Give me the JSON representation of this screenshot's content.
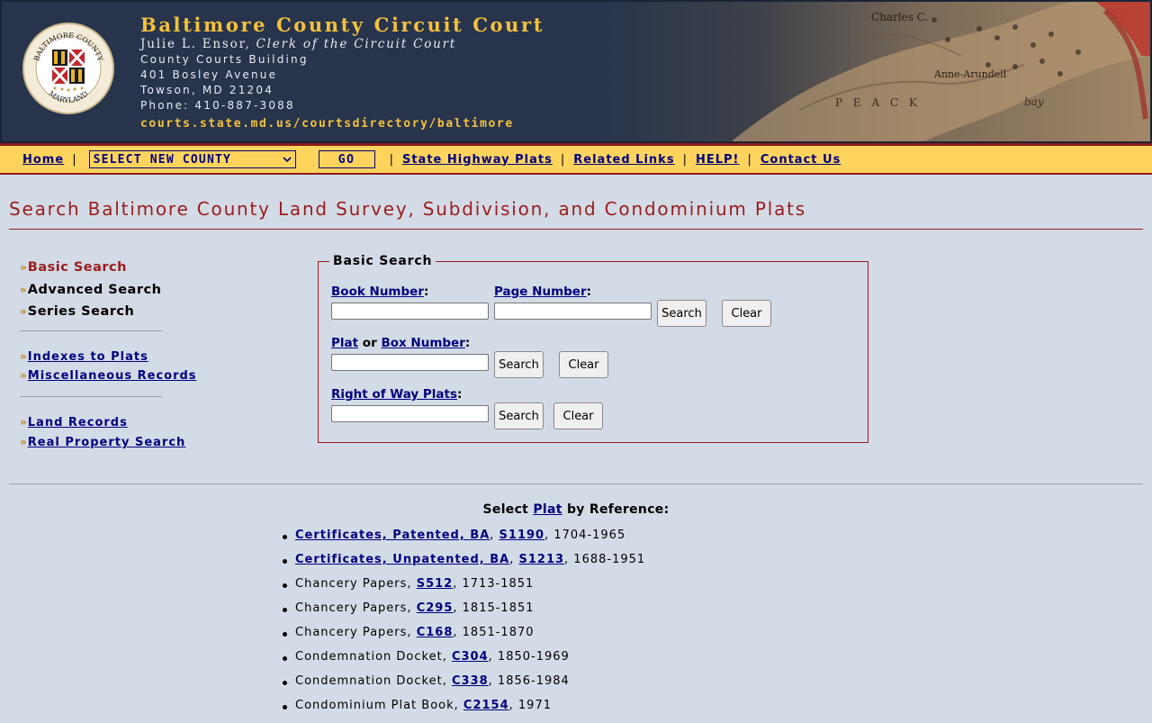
{
  "header": {
    "title": "Baltimore County Circuit Court",
    "clerk_name": "Julie L. Ensor,",
    "clerk_title": "Clerk of the Circuit Court",
    "building": "County Courts Building",
    "street": "401 Bosley Avenue",
    "city": "Towson, MD 21204",
    "phone": "Phone: 410-887-3088",
    "url": "courts.state.md.us/courtsdirectory/baltimore",
    "seal_top": "BALTIMORE COUNTY",
    "seal_bottom": "MARYLAND",
    "map_labels": [
      "Charles C.",
      "Anne-Arundell",
      "P E   A C K",
      "bay"
    ]
  },
  "nav": {
    "home": "Home",
    "sep": "|",
    "county_select": "SELECT NEW COUNTY",
    "go": "GO",
    "state_highway": "State Highway Plats",
    "related": "Related Links",
    "help": "HELP!",
    "contact": "Contact Us"
  },
  "page_title": "Search Baltimore County Land Survey, Subdivision, and Condominium Plats",
  "side": {
    "chevron": "»",
    "basic": "Basic Search",
    "advanced": "Advanced Search",
    "series": "Series Search",
    "indexes": "Indexes to Plats",
    "misc": "Miscellaneous Records",
    "land": "Land Records",
    "property": "Real Property Search"
  },
  "basic_search": {
    "legend": "Basic Search",
    "book_label": "Book Number",
    "page_label": "Page Number",
    "colon": ":",
    "plat": "Plat",
    "or": " or ",
    "box_label": "Box Number",
    "row_label": "Right of Way Plats",
    "search": "Search",
    "clear": "Clear",
    "book_value": "",
    "page_value": "",
    "plat_value": "",
    "row_value": ""
  },
  "references": {
    "head_pre": "Select ",
    "head_link": "Plat",
    "head_post": " by Reference:",
    "items": [
      {
        "pre": "",
        "link1": "Certificates, Patented, BA",
        "mid": ", ",
        "link2": "S1190",
        "post": ", 1704-1965"
      },
      {
        "pre": "",
        "link1": "Certificates, Unpatented, BA",
        "mid": ", ",
        "link2": "S1213",
        "post": ", 1688-1951"
      },
      {
        "pre": "Chancery Papers, ",
        "link2": "S512",
        "post": ", 1713-1851"
      },
      {
        "pre": "Chancery Papers, ",
        "link2": "C295",
        "post": ", 1815-1851"
      },
      {
        "pre": "Chancery Papers, ",
        "link2": "C168",
        "post": ", 1851-1870"
      },
      {
        "pre": "Condemnation Docket, ",
        "link2": "C304",
        "post": ", 1850-1969"
      },
      {
        "pre": "Condemnation Docket, ",
        "link2": "C338",
        "post": ", 1856-1984"
      },
      {
        "pre": "Condominium Plat Book, ",
        "link2": "C2154",
        "post": ", 1971"
      }
    ]
  },
  "colors": {
    "background": "#d3dbe6",
    "banner": "#27344c",
    "gold": "#f5c13c",
    "navbar": "#ffd45c",
    "accent_red": "#9b1c1c",
    "link": "#000080"
  }
}
